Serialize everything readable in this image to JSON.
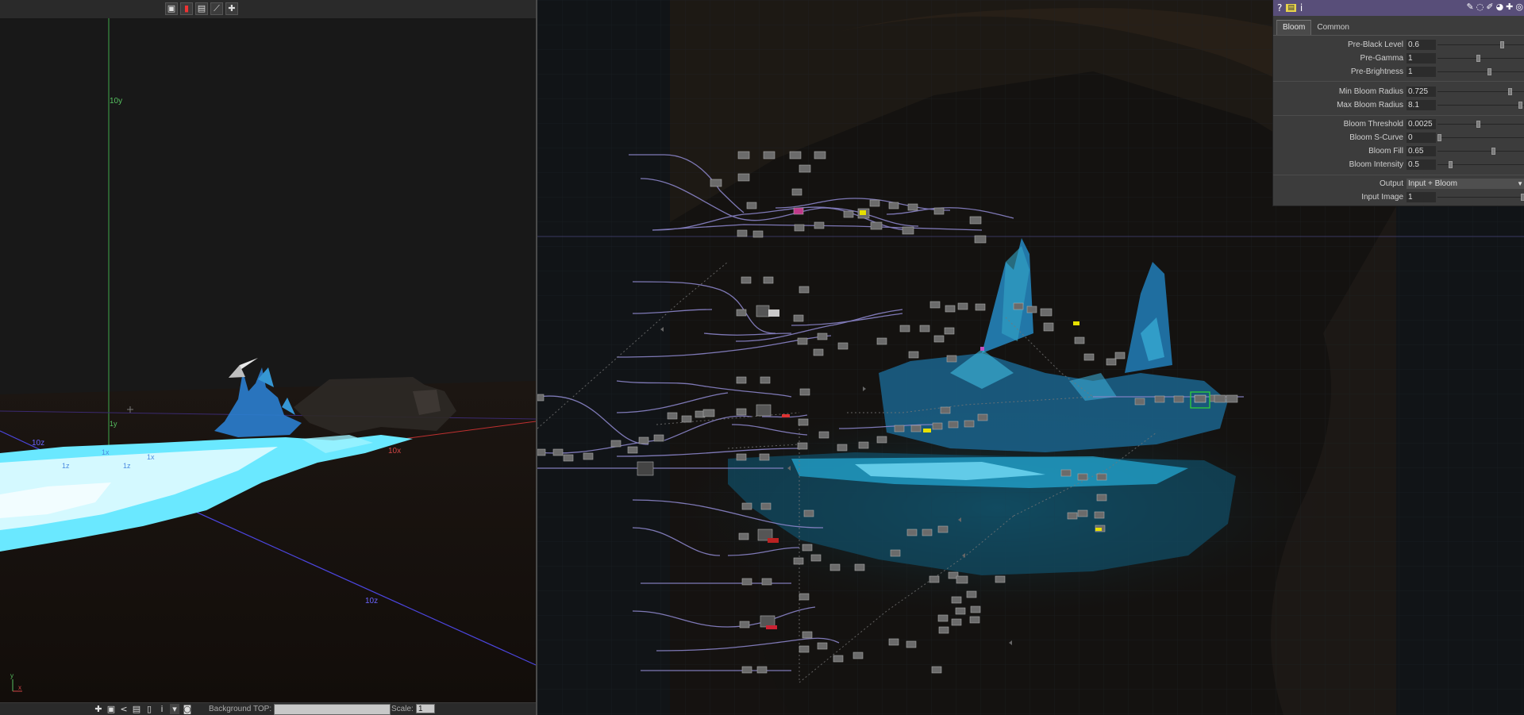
{
  "viewport": {
    "axis_labels": {
      "y_top": "10y",
      "x_right": "10x",
      "z_left": "10z",
      "z_bottom": "10z",
      "y_small": "1y",
      "x_small": "1x",
      "z_small": "1z",
      "x_small2": "1x",
      "z_small2": "1z"
    },
    "corner_axes": {
      "y": "y",
      "x": "x"
    },
    "bottom_bar": {
      "background_top_label": "Background TOP:",
      "background_top_value": "",
      "scale_label": "Scale:",
      "scale_value": "1"
    },
    "top_toolbar_icons": [
      "camera-icon",
      "bookmark-icon",
      "view-icon",
      "wand-icon",
      "add-icon"
    ],
    "bottom_toolbar_icons": [
      "add-icon",
      "camera-icon",
      "lasso-icon",
      "view-icon",
      "delete-icon",
      "info-icon",
      "dropdown-icon",
      "camera-snapshot-icon"
    ]
  },
  "parameters": {
    "header_icons": [
      "help-icon",
      "operator-icon",
      "info-icon",
      "edit-icon",
      "comment-icon",
      "python-icon",
      "color-icon",
      "add-icon",
      "target-icon"
    ],
    "tabs": [
      {
        "label": "Bloom",
        "active": true
      },
      {
        "label": "Common",
        "active": false
      }
    ],
    "rows": [
      {
        "label": "Pre-Black Level",
        "value": "0.6",
        "slider": 0.75
      },
      {
        "label": "Pre-Gamma",
        "value": "1",
        "slider": 0.47
      },
      {
        "label": "Pre-Brightness",
        "value": "1",
        "slider": 0.6
      },
      {
        "label": "Min Bloom Radius",
        "value": "0.725",
        "slider": 0.85
      },
      {
        "label": "Max Bloom Radius",
        "value": "8.1",
        "slider": 0.97
      },
      {
        "label": "Bloom Threshold",
        "value": "0.0025",
        "slider": 0.47
      },
      {
        "label": "Bloom S-Curve",
        "value": "0",
        "slider": 0.0
      },
      {
        "label": "Bloom Fill",
        "value": "0.65",
        "slider": 0.65
      },
      {
        "label": "Bloom Intensity",
        "value": "0.5",
        "slider": 0.13
      },
      {
        "label": "Output",
        "value": "Input + Bloom",
        "menu": true
      },
      {
        "label": "Input Image",
        "value": "1",
        "slider": 1.0
      }
    ]
  },
  "colors": {
    "panel_header": "#584e79",
    "wire": "#8a84c8",
    "selected_node": "#2fd13a",
    "point_cloud": "#1ec8ff"
  }
}
